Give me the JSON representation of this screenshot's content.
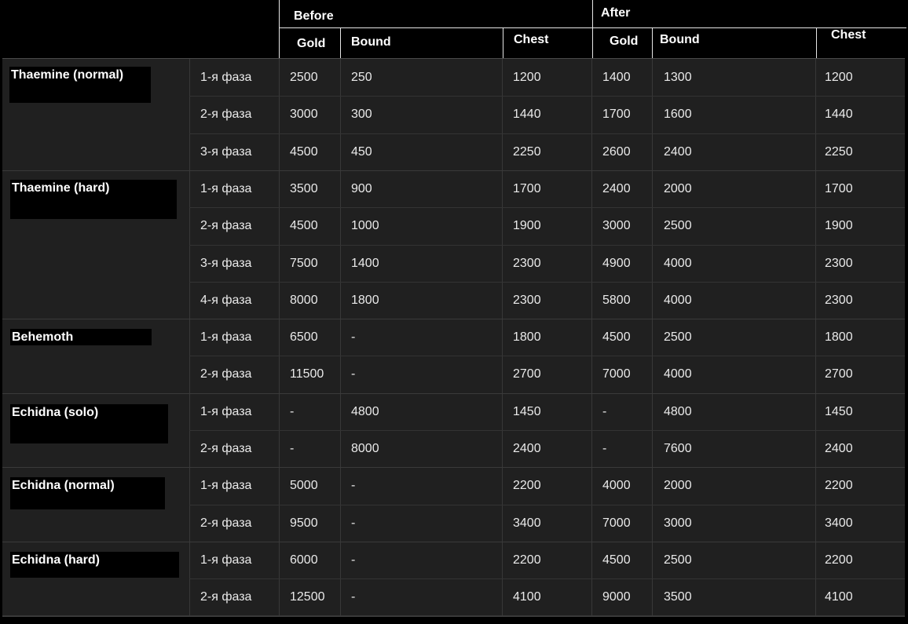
{
  "header": {
    "before_label": "Before",
    "after_label": "After",
    "before_cols": [
      "Gold",
      "Bound",
      "Chest"
    ],
    "after_cols": [
      "Gold",
      "Bound",
      "Chest"
    ]
  },
  "groups": [
    {
      "boss": "Thaemine (normal)",
      "rows": [
        {
          "phase": "1-я фаза",
          "b_gold": "2500",
          "b_bound": "250",
          "b_chest": "1200",
          "a_gold": "1400",
          "a_bound": "1300",
          "a_chest": "1200"
        },
        {
          "phase": "2-я фаза",
          "b_gold": "3000",
          "b_bound": "300",
          "b_chest": "1440",
          "a_gold": "1700",
          "a_bound": "1600",
          "a_chest": "1440"
        },
        {
          "phase": "3-я фаза",
          "b_gold": "4500",
          "b_bound": "450",
          "b_chest": "2250",
          "a_gold": "2600",
          "a_bound": "2400",
          "a_chest": "2250"
        }
      ]
    },
    {
      "boss": "Thaemine (hard)",
      "rows": [
        {
          "phase": "1-я фаза",
          "b_gold": "3500",
          "b_bound": "900",
          "b_chest": "1700",
          "a_gold": "2400",
          "a_bound": "2000",
          "a_chest": "1700"
        },
        {
          "phase": "2-я фаза",
          "b_gold": "4500",
          "b_bound": "1000",
          "b_chest": "1900",
          "a_gold": "3000",
          "a_bound": "2500",
          "a_chest": "1900"
        },
        {
          "phase": "3-я фаза",
          "b_gold": "7500",
          "b_bound": "1400",
          "b_chest": "2300",
          "a_gold": "4900",
          "a_bound": "4000",
          "a_chest": "2300"
        },
        {
          "phase": "4-я фаза",
          "b_gold": "8000",
          "b_bound": "1800",
          "b_chest": "2300",
          "a_gold": "5800",
          "a_bound": "4000",
          "a_chest": "2300"
        }
      ]
    },
    {
      "boss": "Behemoth",
      "rows": [
        {
          "phase": "1-я фаза",
          "b_gold": "6500",
          "b_bound": "-",
          "b_chest": "1800",
          "a_gold": "4500",
          "a_bound": "2500",
          "a_chest": "1800"
        },
        {
          "phase": "2-я фаза",
          "b_gold": "11500",
          "b_bound": "-",
          "b_chest": "2700",
          "a_gold": "7000",
          "a_bound": "4000",
          "a_chest": "2700"
        }
      ]
    },
    {
      "boss": "Echidna (solo)",
      "rows": [
        {
          "phase": "1-я фаза",
          "b_gold": "-",
          "b_bound": "4800",
          "b_chest": "1450",
          "a_gold": "-",
          "a_bound": "4800",
          "a_chest": "1450"
        },
        {
          "phase": "2-я фаза",
          "b_gold": "-",
          "b_bound": "8000",
          "b_chest": "2400",
          "a_gold": "-",
          "a_bound": "7600",
          "a_chest": "2400"
        }
      ]
    },
    {
      "boss": "Echidna (normal)",
      "rows": [
        {
          "phase": "1-я фаза",
          "b_gold": "5000",
          "b_bound": "-",
          "b_chest": "2200",
          "a_gold": "4000",
          "a_bound": "2000",
          "a_chest": "2200"
        },
        {
          "phase": "2-я фаза",
          "b_gold": "9500",
          "b_bound": "-",
          "b_chest": "3400",
          "a_gold": "7000",
          "a_bound": "3000",
          "a_chest": "3400"
        }
      ]
    },
    {
      "boss": "Echidna (hard)",
      "rows": [
        {
          "phase": "1-я фаза",
          "b_gold": "6000",
          "b_bound": "-",
          "b_chest": "2200",
          "a_gold": "4500",
          "a_bound": "2500",
          "a_chest": "2200"
        },
        {
          "phase": "2-я фаза",
          "b_gold": "12500",
          "b_bound": "-",
          "b_chest": "4100",
          "a_gold": "9000",
          "a_bound": "3500",
          "a_chest": "4100"
        }
      ]
    }
  ]
}
